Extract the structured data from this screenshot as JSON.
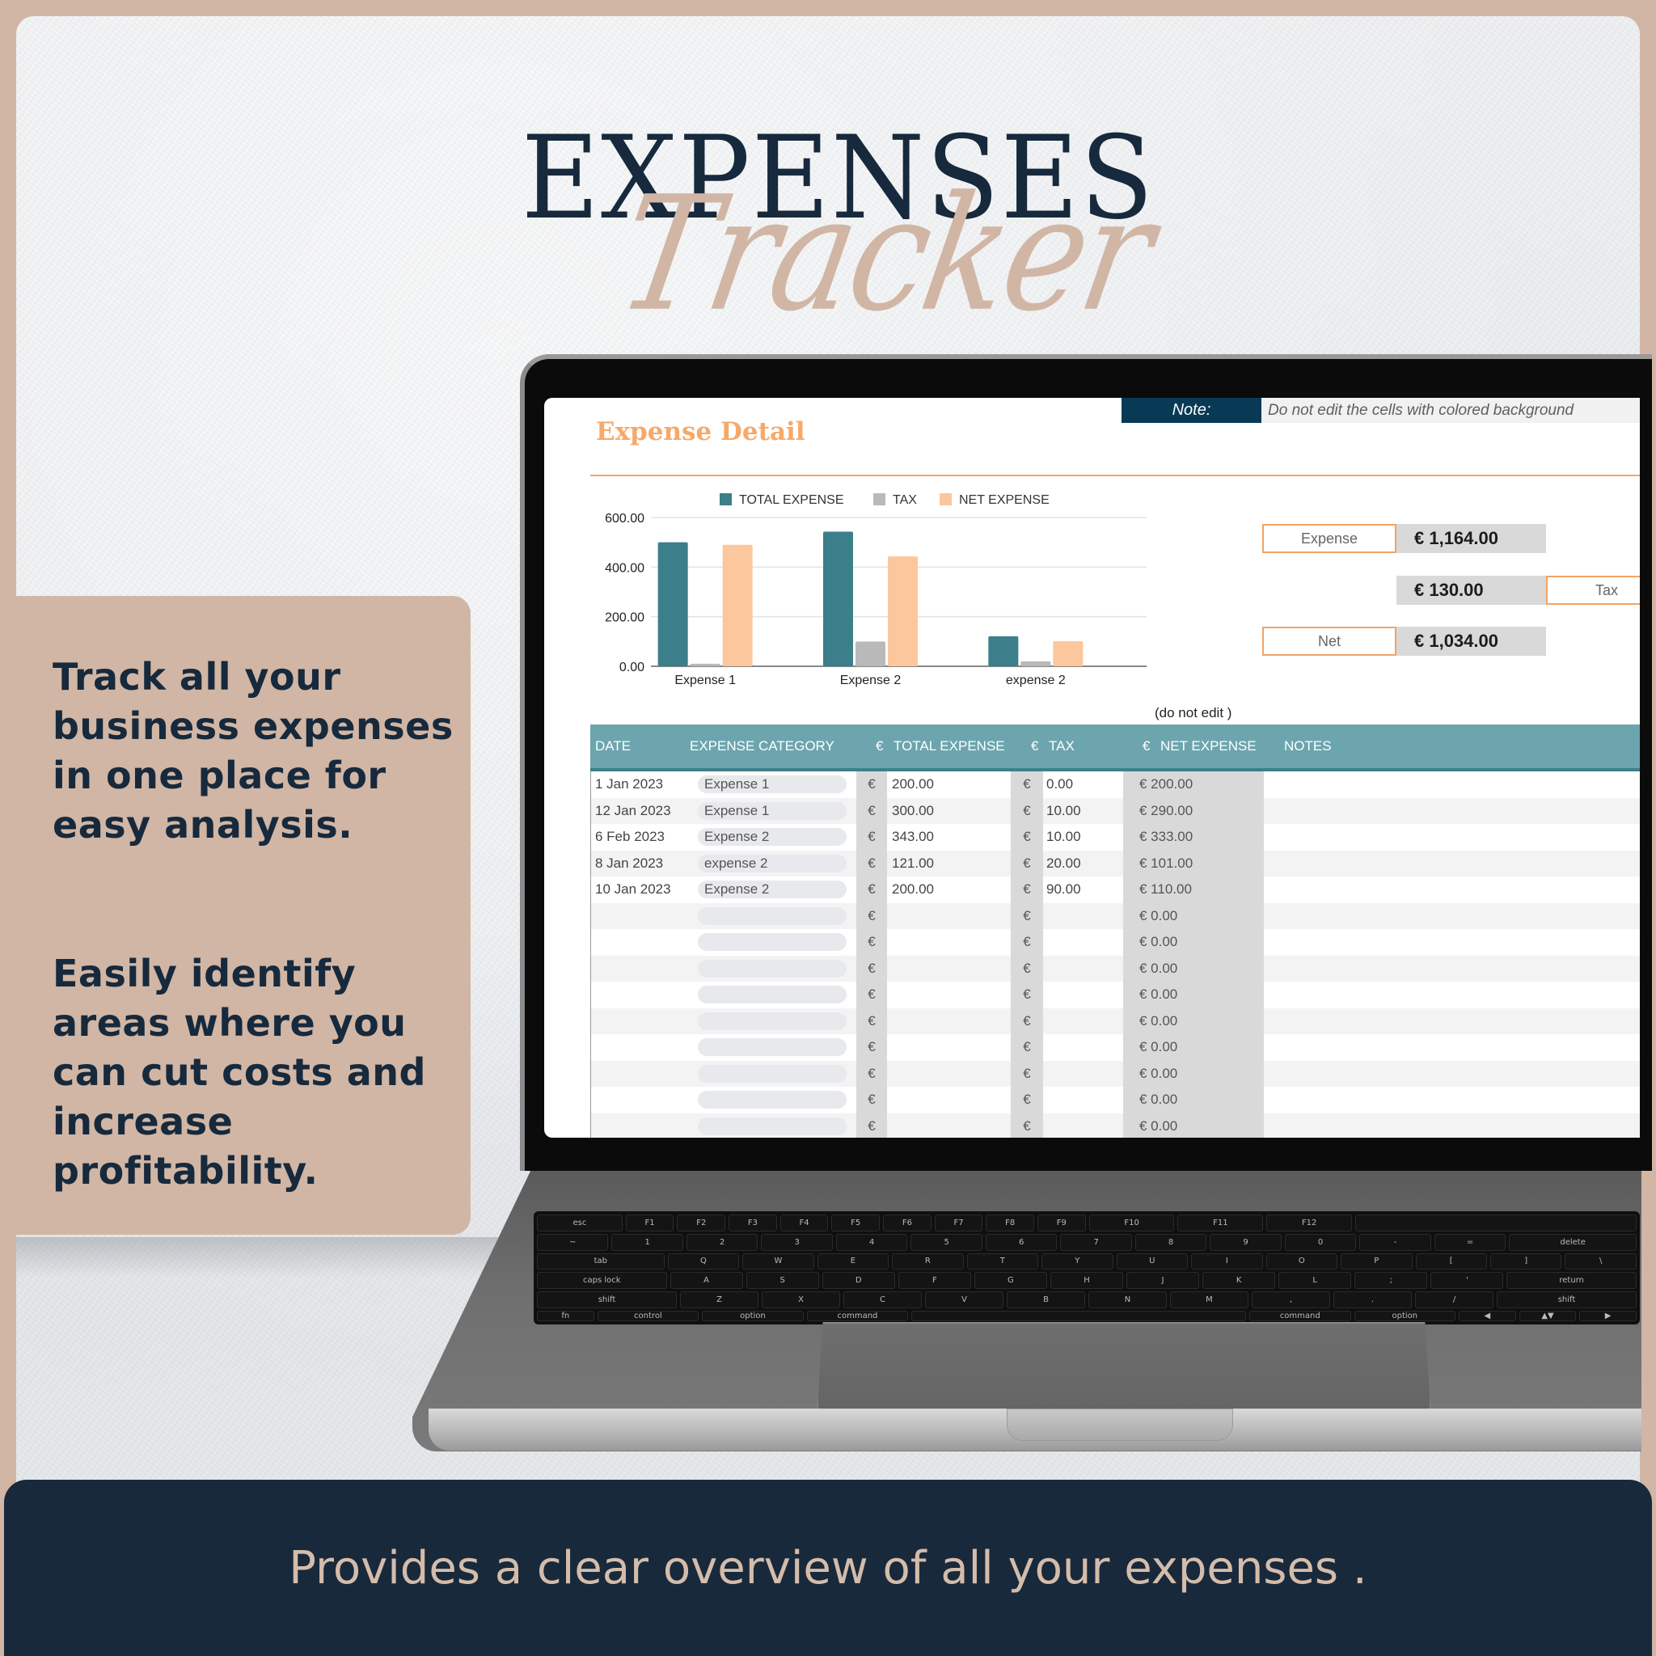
{
  "header": {
    "title": "EXPENSES",
    "script_title": "Tracker"
  },
  "left_panel": {
    "paragraph_1": "Track all your business expenses in one place for easy analysis.",
    "paragraph_2": "Easily identify areas where you can cut costs and increase profitability."
  },
  "banner": {
    "text": "Provides a clear overview of all your expenses ."
  },
  "sheet": {
    "title": "Expense Detail",
    "note_label": "Note:",
    "note_text": "Do not edit the cells with colored background",
    "do_not_edit": "(do not edit )",
    "summary": {
      "expense_label": "Expense",
      "expense_value": "€ 1,164.00",
      "tax_label": "Tax",
      "tax_value": "€ 130.00",
      "net_label": "Net",
      "net_value": "€ 1,034.00"
    },
    "columns": {
      "date": "DATE",
      "category": "EXPENSE CATEGORY",
      "total_currency": "€",
      "total": "TOTAL EXPENSE",
      "tax_currency": "€",
      "tax": "TAX",
      "net_currency": "€",
      "net": "NET EXPENSE",
      "notes": "NOTES"
    },
    "currency_symbol": "€",
    "rows": [
      {
        "date": "1 Jan 2023",
        "category": "Expense 1",
        "total": "200.00",
        "tax": "0.00",
        "net": "€ 200.00",
        "notes": ""
      },
      {
        "date": "12 Jan 2023",
        "category": "Expense 1",
        "total": "300.00",
        "tax": "10.00",
        "net": "€ 290.00",
        "notes": ""
      },
      {
        "date": "6 Feb 2023",
        "category": "Expense 2",
        "total": "343.00",
        "tax": "10.00",
        "net": "€ 333.00",
        "notes": ""
      },
      {
        "date": "8 Jan 2023",
        "category": "expense 2",
        "total": "121.00",
        "tax": "20.00",
        "net": "€ 101.00",
        "notes": ""
      },
      {
        "date": "10 Jan 2023",
        "category": "Expense 2",
        "total": "200.00",
        "tax": "90.00",
        "net": "€ 110.00",
        "notes": ""
      },
      {
        "date": "",
        "category": "",
        "total": "",
        "tax": "",
        "net": "€ 0.00",
        "notes": ""
      },
      {
        "date": "",
        "category": "",
        "total": "",
        "tax": "",
        "net": "€ 0.00",
        "notes": ""
      },
      {
        "date": "",
        "category": "",
        "total": "",
        "tax": "",
        "net": "€ 0.00",
        "notes": ""
      },
      {
        "date": "",
        "category": "",
        "total": "",
        "tax": "",
        "net": "€ 0.00",
        "notes": ""
      },
      {
        "date": "",
        "category": "",
        "total": "",
        "tax": "",
        "net": "€ 0.00",
        "notes": ""
      },
      {
        "date": "",
        "category": "",
        "total": "",
        "tax": "",
        "net": "€ 0.00",
        "notes": ""
      },
      {
        "date": "",
        "category": "",
        "total": "",
        "tax": "",
        "net": "€ 0.00",
        "notes": ""
      },
      {
        "date": "",
        "category": "",
        "total": "",
        "tax": "",
        "net": "€ 0.00",
        "notes": ""
      },
      {
        "date": "",
        "category": "",
        "total": "",
        "tax": "",
        "net": "€ 0.00",
        "notes": ""
      }
    ]
  },
  "keyboard": {
    "rows": [
      [
        "esc",
        "F1",
        "F2",
        "F3",
        "F4",
        "F5",
        "F6",
        "F7",
        "F8",
        "F9",
        "F10",
        "F11",
        "F12",
        ""
      ],
      [
        "~",
        "1",
        "2",
        "3",
        "4",
        "5",
        "6",
        "7",
        "8",
        "9",
        "0",
        "-",
        "=",
        "delete"
      ],
      [
        "tab",
        "Q",
        "W",
        "E",
        "R",
        "T",
        "Y",
        "U",
        "I",
        "O",
        "P",
        "[",
        "]",
        "\\"
      ],
      [
        "caps lock",
        "A",
        "S",
        "D",
        "F",
        "G",
        "H",
        "J",
        "K",
        "L",
        ";",
        "'",
        "return"
      ],
      [
        "shift",
        "Z",
        "X",
        "C",
        "V",
        "B",
        "N",
        "M",
        ",",
        ".",
        "/",
        "shift"
      ],
      [
        "fn",
        "control",
        "option",
        "command",
        "",
        "command",
        "option",
        "◀",
        "▲▼",
        "▶"
      ]
    ]
  },
  "colors": {
    "frame": "#d1b6a5",
    "navy": "#17293c",
    "total_expense": "#3a7f8a",
    "tax": "#b9b9b9",
    "net_expense": "#fcc79c",
    "sheet_title": "#f6a96a",
    "table_header": "#6ca5ae"
  },
  "chart_data": {
    "type": "bar",
    "title": "",
    "xlabel": "",
    "ylabel": "",
    "categories": [
      "Expense 1",
      "Expense 2",
      "expense 2"
    ],
    "series": [
      {
        "name": "TOTAL EXPENSE",
        "color": "#3a7f8a",
        "values": [
          500,
          543,
          121
        ]
      },
      {
        "name": "TAX",
        "color": "#b9b9b9",
        "values": [
          10,
          100,
          20
        ]
      },
      {
        "name": "NET EXPENSE",
        "color": "#fcc79c",
        "values": [
          490,
          443,
          101
        ]
      }
    ],
    "ylim": [
      0,
      600
    ],
    "yticks": [
      "0.00",
      "200.00",
      "400.00",
      "600.00"
    ],
    "ytick_values": [
      0,
      200,
      400,
      600
    ],
    "grid": true,
    "legend": "top"
  }
}
